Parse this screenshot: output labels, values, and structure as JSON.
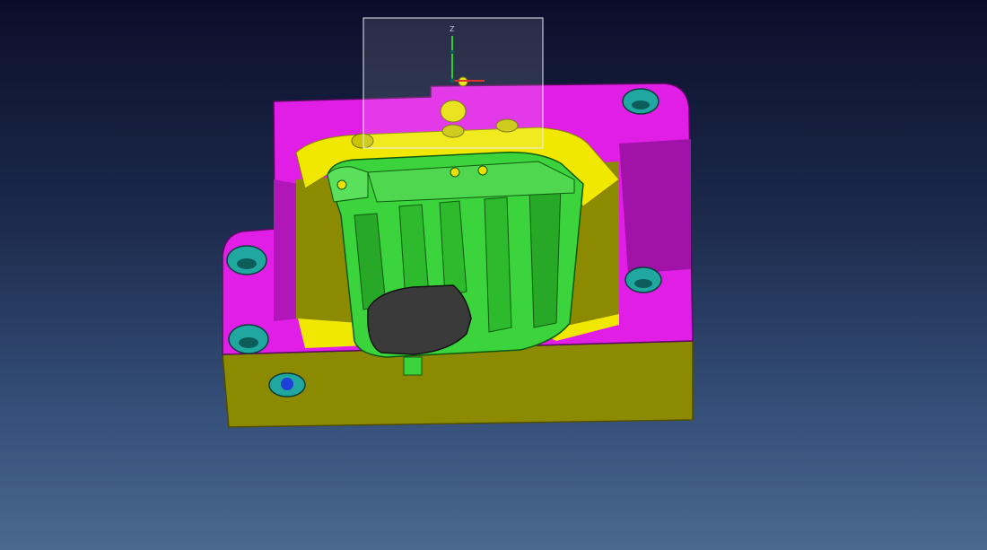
{
  "viewport": {
    "background_top": "#0b0e2a",
    "background_bottom": "#4a6890"
  },
  "triad": {
    "z_label": "Z"
  },
  "colors": {
    "mold_plate": "#e01ee6",
    "mold_plate_shadow": "#a012a8",
    "cavity_side": "#8c8a00",
    "cavity_rim": "#f0e800",
    "part": "#3cd43c",
    "part_dark": "#1f8f1f",
    "insert": "#3a3a3a",
    "bolt_hole": "#1fa7a0",
    "selection_box": "#ffffff"
  },
  "icons": {
    "triad": "xyz-triad-icon",
    "blue_marker": "blue-dot-icon"
  }
}
